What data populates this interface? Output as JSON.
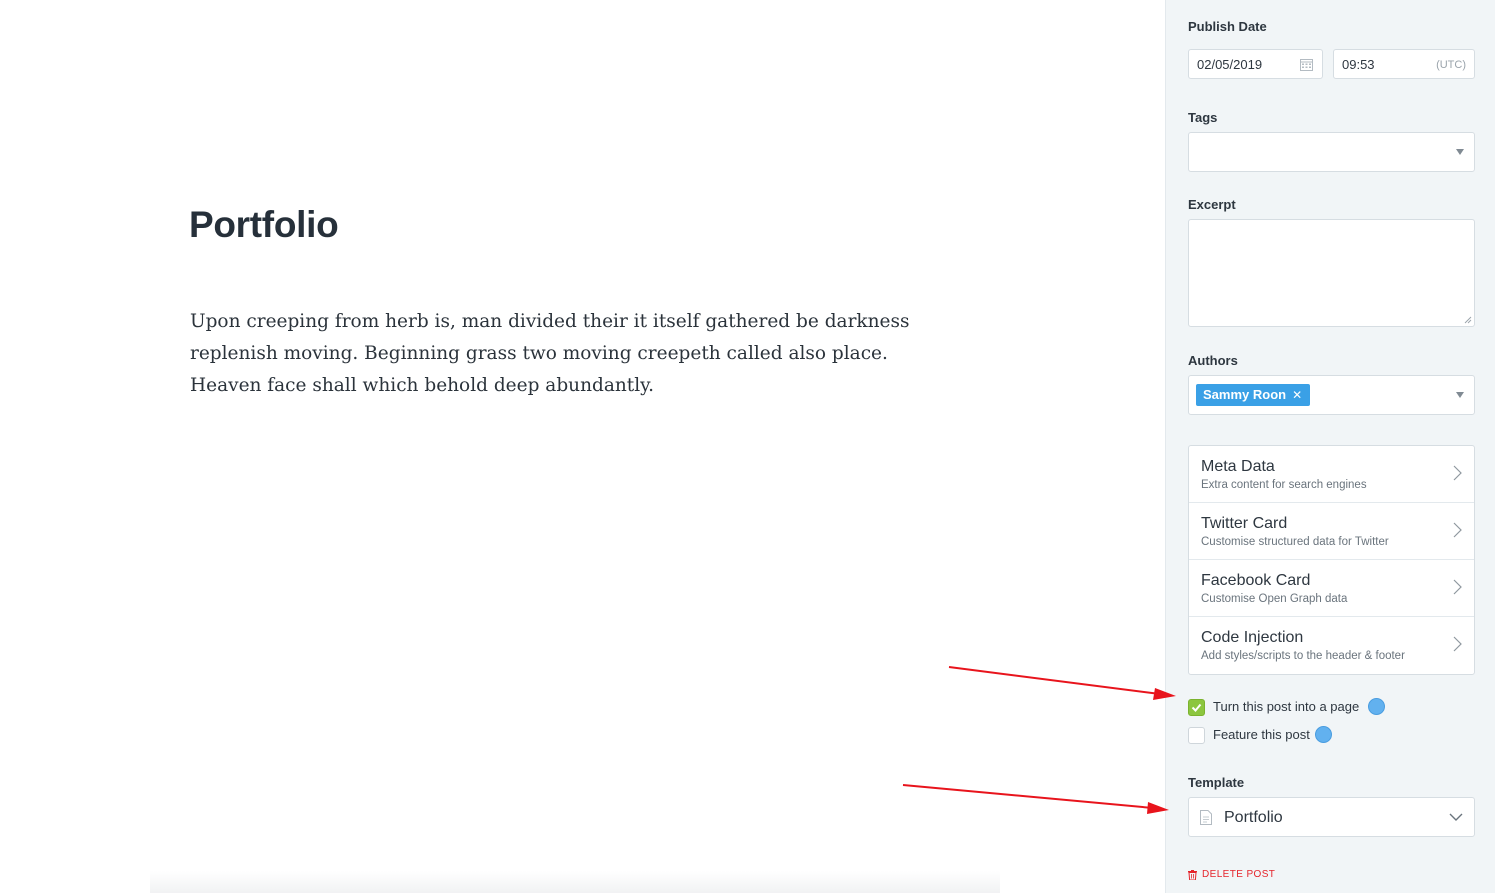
{
  "editor": {
    "title": "Portfolio",
    "body": "Upon creeping from herb is, man divided their it itself gathered be darkness replenish moving. Beginning grass two moving creepeth called also place. Heaven face shall which behold deep abundantly."
  },
  "sidebar": {
    "publish_date": {
      "label": "Publish Date",
      "date": "02/05/2019",
      "time": "09:53",
      "timezone": "(UTC)"
    },
    "tags": {
      "label": "Tags",
      "value": ""
    },
    "excerpt": {
      "label": "Excerpt",
      "value": ""
    },
    "authors": {
      "label": "Authors",
      "selected": [
        "Sammy Roon"
      ]
    },
    "menu": [
      {
        "title": "Meta Data",
        "subtitle": "Extra content for search engines"
      },
      {
        "title": "Twitter Card",
        "subtitle": "Customise structured data for Twitter"
      },
      {
        "title": "Facebook Card",
        "subtitle": "Customise Open Graph data"
      },
      {
        "title": "Code Injection",
        "subtitle": "Add styles/scripts to the header & footer"
      }
    ],
    "options": {
      "turn_into_page": {
        "label": "Turn this post into a page",
        "checked": true
      },
      "feature_post": {
        "label": "Feature this post",
        "checked": false
      }
    },
    "template": {
      "label": "Template",
      "value": "Portfolio"
    },
    "delete_label": "DELETE POST"
  },
  "colors": {
    "accent": "#3aa0e6",
    "checkbox_checked": "#8cc63f",
    "delete": "#e5242b",
    "annotation_arrow": "#e8141c",
    "sidebar_bg": "#f1f5f7"
  },
  "icons": [
    "calendar-icon",
    "dropdown-caret-icon",
    "remove-x-icon",
    "chevron-right-icon",
    "checkmark-icon",
    "help-icon",
    "document-icon",
    "chevron-down-icon",
    "trash-icon"
  ]
}
